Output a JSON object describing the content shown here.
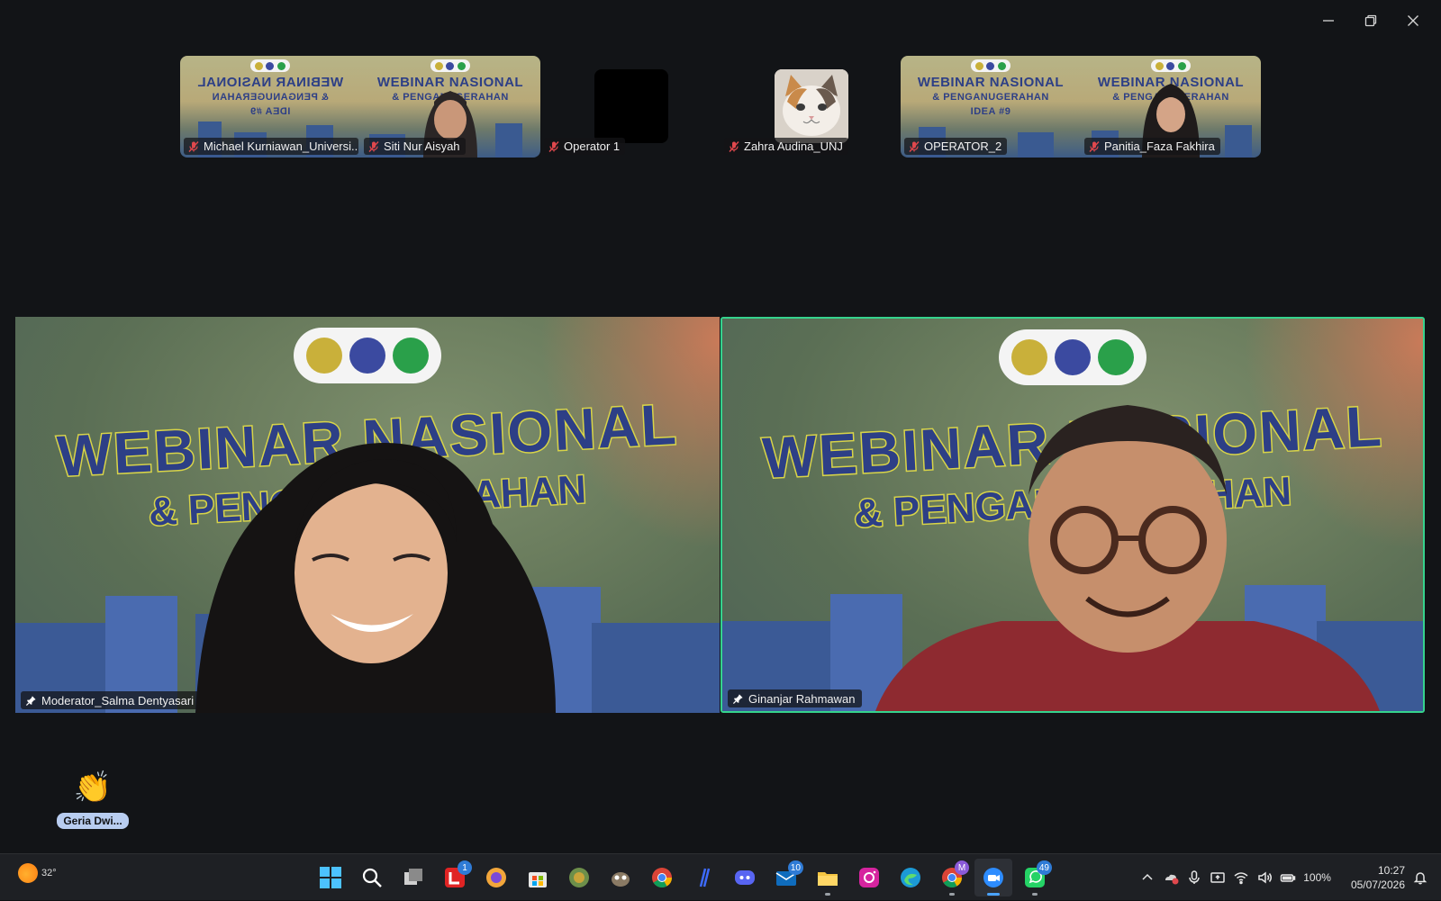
{
  "window": {
    "controls": [
      "minimize",
      "restore",
      "close"
    ]
  },
  "gallery": [
    {
      "name": "Michael Kurniawan_Universi...",
      "muted": true,
      "type": "banner-flip"
    },
    {
      "name": "Siti Nur Aisyah",
      "muted": true,
      "type": "banner-person"
    },
    {
      "name": "Operator 1",
      "muted": true,
      "type": "black"
    },
    {
      "name": "Zahra Audina_UNJ",
      "muted": true,
      "type": "cat"
    },
    {
      "name": "OPERATOR_2",
      "muted": true,
      "type": "banner"
    },
    {
      "name": "Panitia_Faza Fakhira",
      "muted": true,
      "type": "banner-person"
    }
  ],
  "banner_text": {
    "line1": "WEBINAR NASIONAL",
    "line2": "& PENGANUGERAHAN",
    "line3": "IDEA #9",
    "big_line1": "WEBINAR NASIONAL",
    "big_line2": "& PENGANUGERAHAN"
  },
  "spotlight": [
    {
      "name": "Moderator_Salma Dentyasari",
      "active_speaker": false
    },
    {
      "name": "Ginanjar Rahmawan",
      "active_speaker": true
    }
  ],
  "reaction": {
    "emoji": "👏",
    "who": "Geria Dwi..."
  },
  "taskbar": {
    "weather": "32°",
    "badges": {
      "lark": "1",
      "mail": "10",
      "chrome_profile": "M",
      "whatsapp": "49"
    },
    "battery": "100%",
    "time": "10:27",
    "date": "05/07/2026"
  },
  "colors": {
    "background": "#121417",
    "active_speaker_border": "#35d38d",
    "banner_blue": "#2d3f86",
    "banner_yellow": "#d8d448"
  }
}
